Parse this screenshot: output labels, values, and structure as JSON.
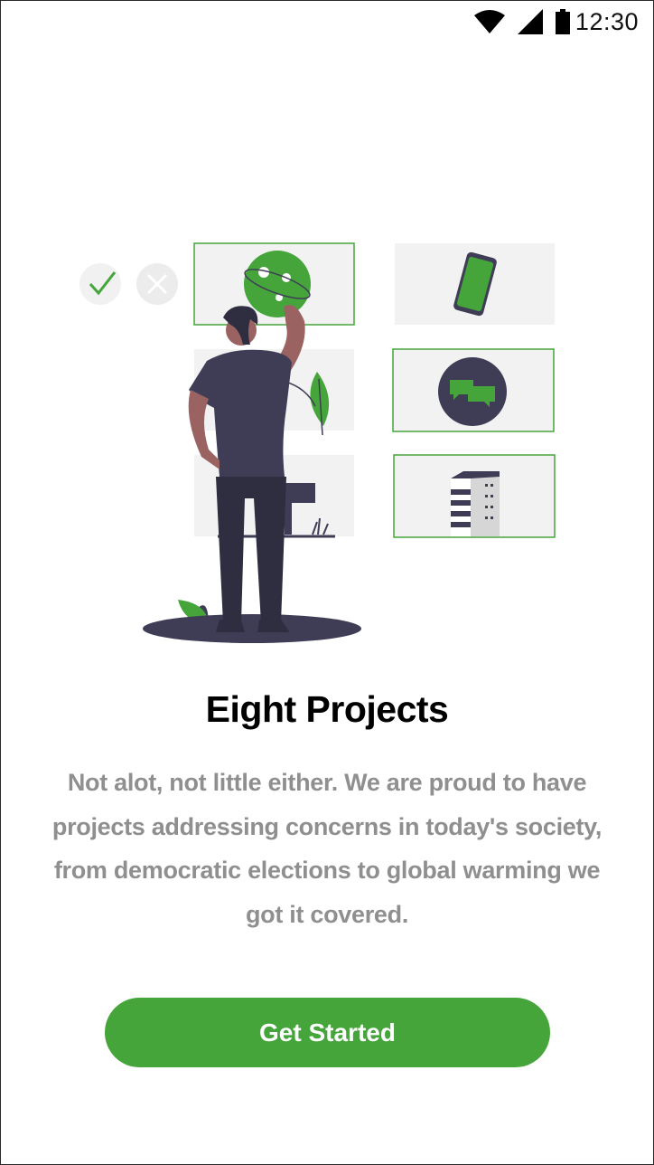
{
  "status_bar": {
    "time": "12:30",
    "icons": [
      "wifi-icon",
      "cellular-signal-icon",
      "battery-icon"
    ]
  },
  "onboarding": {
    "illustration": "person-choosing-projects-illustration",
    "title": "Eight Projects",
    "description": "Not alot, not little either. We are proud to have projects addressing concerns in today's society, from democratic elections to global warming we got it covered.",
    "cta_label": "Get Started"
  },
  "colors": {
    "accent": "#45a53b",
    "dark": "#3f3d56",
    "description_text": "#8f8f8f",
    "title_text": "#000000"
  }
}
